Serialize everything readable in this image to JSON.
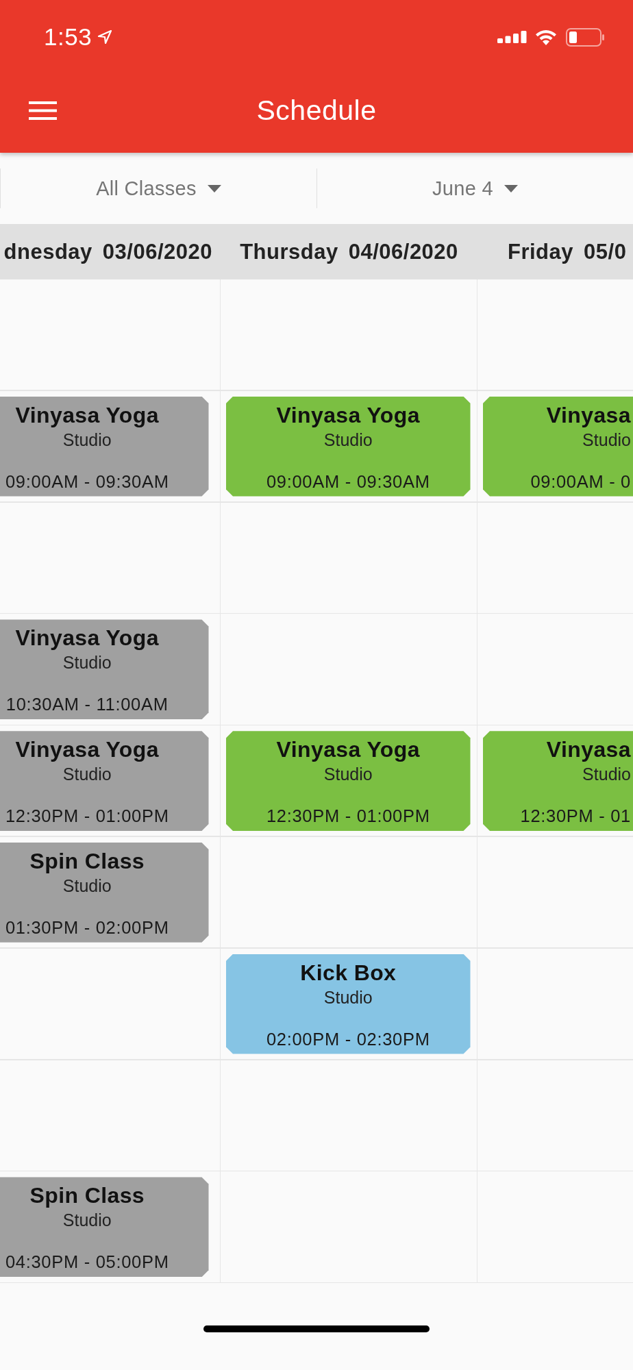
{
  "status_bar": {
    "time": "1:53"
  },
  "app_bar": {
    "title": "Schedule"
  },
  "filters": [
    {
      "label": "All Classes"
    },
    {
      "label": "June 4"
    }
  ],
  "days": [
    {
      "weekday": "dnesday",
      "date": "03/06/2020"
    },
    {
      "weekday": "Thursday",
      "date": "04/06/2020"
    },
    {
      "weekday": "Friday",
      "date": "05/0"
    }
  ],
  "rows": [
    {
      "cells": [
        null,
        null,
        null
      ]
    },
    {
      "cells": [
        {
          "title": "Vinyasa Yoga",
          "location": "Studio",
          "time": "09:00AM - 09:30AM",
          "color": "#a0a0a0"
        },
        {
          "title": "Vinyasa Yoga",
          "location": "Studio",
          "time": "09:00AM - 09:30AM",
          "color": "#7bbf42"
        },
        {
          "title": "Vinyasa",
          "location": "Studio",
          "time": "09:00AM - 0",
          "color": "#7bbf42"
        }
      ]
    },
    {
      "cells": [
        null,
        null,
        null
      ]
    },
    {
      "cells": [
        {
          "title": "Vinyasa Yoga",
          "location": "Studio",
          "time": "10:30AM - 11:00AM",
          "color": "#a0a0a0"
        },
        null,
        null
      ]
    },
    {
      "cells": [
        {
          "title": "Vinyasa Yoga",
          "location": "Studio",
          "time": "12:30PM - 01:00PM",
          "color": "#a0a0a0"
        },
        {
          "title": "Vinyasa Yoga",
          "location": "Studio",
          "time": "12:30PM - 01:00PM",
          "color": "#7bbf42"
        },
        {
          "title": "Vinyasa",
          "location": "Studio",
          "time": "12:30PM - 01",
          "color": "#7bbf42"
        }
      ]
    },
    {
      "cells": [
        {
          "title": "Spin Class",
          "location": "Studio",
          "time": "01:30PM - 02:00PM",
          "color": "#a0a0a0"
        },
        null,
        null
      ]
    },
    {
      "cells": [
        null,
        {
          "title": "Kick Box",
          "location": "Studio",
          "time": "02:00PM - 02:30PM",
          "color": "#86c4e4"
        },
        null
      ]
    },
    {
      "cells": [
        null,
        null,
        null
      ]
    },
    {
      "cells": [
        {
          "title": "Spin Class",
          "location": "Studio",
          "time": "04:30PM - 05:00PM",
          "color": "#a0a0a0"
        },
        null,
        null
      ]
    }
  ]
}
